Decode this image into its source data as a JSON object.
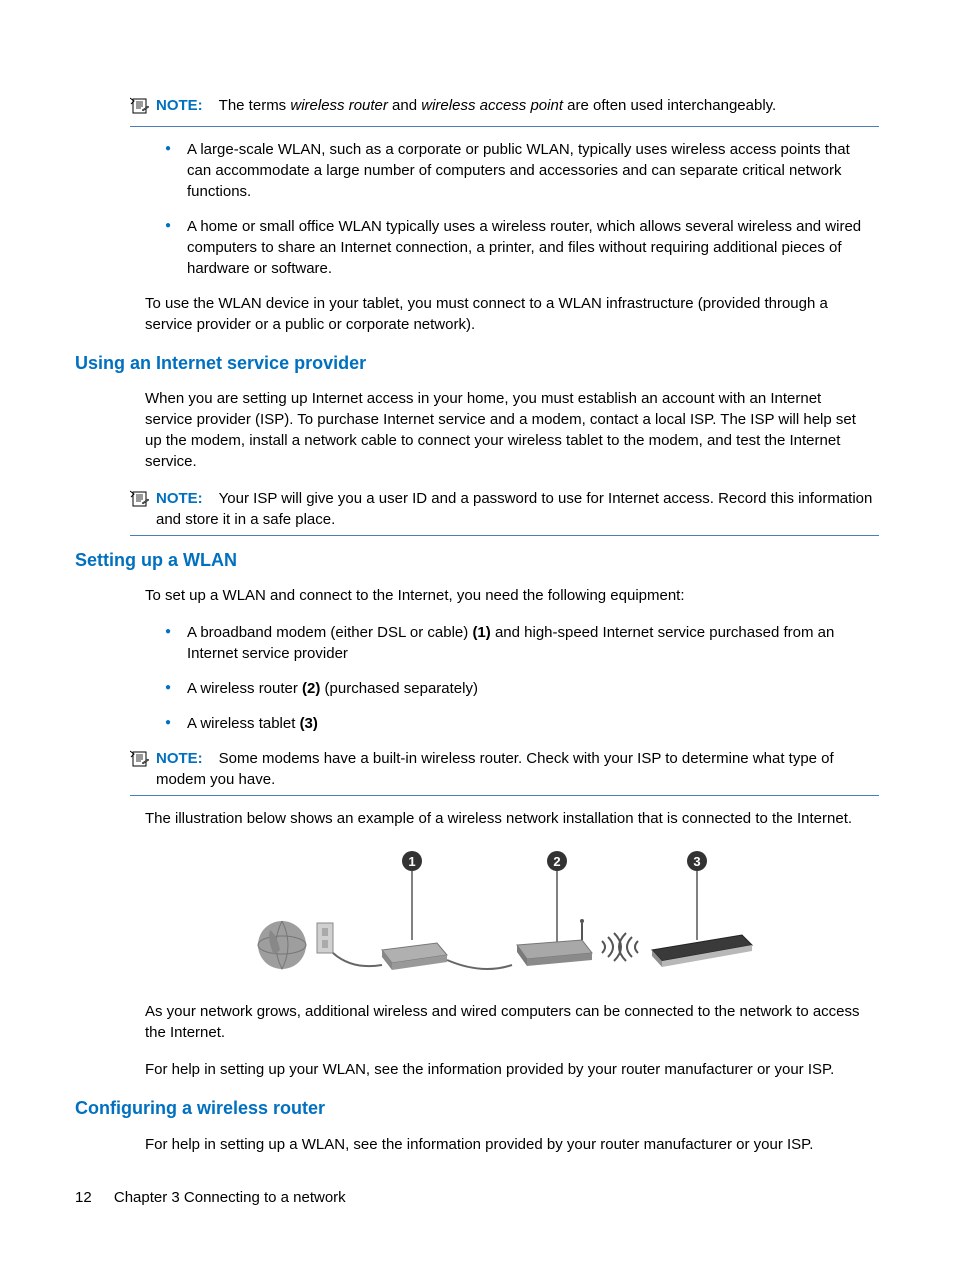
{
  "notes": {
    "note1": {
      "label": "NOTE:",
      "text_before": "The terms ",
      "italic1": "wireless router",
      "text_mid": " and ",
      "italic2": "wireless access point",
      "text_after": " are often used interchangeably."
    },
    "note2": {
      "label": "NOTE:",
      "text": "Your ISP will give you a user ID and a password to use for Internet access. Record this information and store it in a safe place."
    },
    "note3": {
      "label": "NOTE:",
      "text": "Some modems have a built-in wireless router. Check with your ISP to determine what type of modem you have."
    }
  },
  "bullets1": [
    "A large-scale WLAN, such as a corporate or public WLAN, typically uses wireless access points that can accommodate a large number of computers and accessories and can separate critical network functions.",
    "A home or small office WLAN typically uses a wireless router, which allows several wireless and wired computers to share an Internet connection, a printer, and files without requiring additional pieces of hardware or software."
  ],
  "para1": "To use the WLAN device in your tablet, you must connect to a WLAN infrastructure (provided through a service provider or a public or corporate network).",
  "heading1": "Using an Internet service provider",
  "para2": "When you are setting up Internet access in your home, you must establish an account with an Internet service provider (ISP). To purchase Internet service and a modem, contact a local ISP. The ISP will help set up the modem, install a network cable to connect your wireless tablet to the modem, and test the Internet service.",
  "heading2": "Setting up a WLAN",
  "para3": "To set up a WLAN and connect to the Internet, you need the following equipment:",
  "bullets2": {
    "item1_before": "A broadband modem (either DSL or cable) ",
    "item1_bold": "(1)",
    "item1_after": " and high-speed Internet service purchased from an Internet service provider",
    "item2_before": "A wireless router ",
    "item2_bold": "(2)",
    "item2_after": " (purchased separately)",
    "item3_before": "A wireless tablet ",
    "item3_bold": "(3)"
  },
  "para4": "The illustration below shows an example of a wireless network installation that is connected to the Internet.",
  "para5": "As your network grows, additional wireless and wired computers can be connected to the network to access the Internet.",
  "para6": "For help in setting up your WLAN, see the information provided by your router manufacturer or your ISP.",
  "heading3": "Configuring a wireless router",
  "para7": "For help in setting up a WLAN, see the information provided by your router manufacturer or your ISP.",
  "footer": {
    "page": "12",
    "chapter": "Chapter 3   Connecting to a network"
  }
}
